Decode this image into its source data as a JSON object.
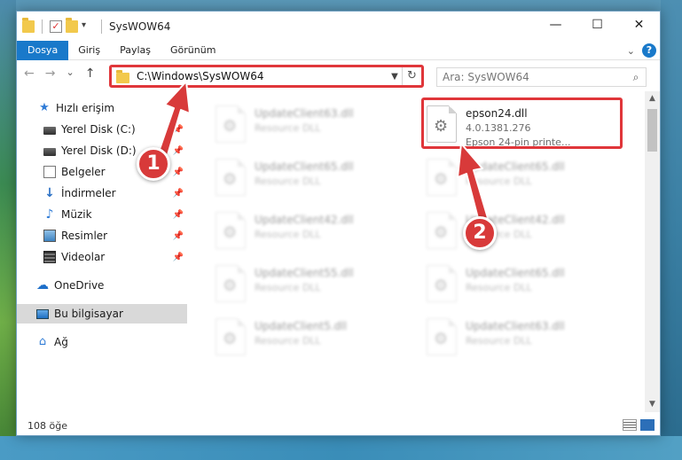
{
  "window": {
    "title": "SysWOW64",
    "controls": {
      "minimize": "—",
      "maximize": "☐",
      "close": "✕"
    }
  },
  "ribbon": {
    "tabs": [
      "Dosya",
      "Giriş",
      "Paylaş",
      "Görünüm"
    ],
    "expand_icon": "chevron-down-icon",
    "help_label": "?"
  },
  "nav": {
    "back": "←",
    "forward": "→",
    "recent": "⌄",
    "up": "↑",
    "address": "C:\\Windows\\SysWOW64",
    "refresh": "↻",
    "search_placeholder": "Ara: SysWOW64"
  },
  "sidebar": {
    "quick_access": "Hızlı erişim",
    "items": [
      {
        "label": "Yerel Disk (C:)",
        "icon": "drive-icon",
        "pinned": true
      },
      {
        "label": "Yerel Disk (D:)",
        "icon": "drive-icon",
        "pinned": true
      },
      {
        "label": "Belgeler",
        "icon": "documents-icon",
        "pinned": true
      },
      {
        "label": "İndirmeler",
        "icon": "download-icon",
        "pinned": true
      },
      {
        "label": "Müzik",
        "icon": "music-icon",
        "pinned": true
      },
      {
        "label": "Resimler",
        "icon": "pictures-icon",
        "pinned": true
      },
      {
        "label": "Videolar",
        "icon": "videos-icon",
        "pinned": true
      }
    ],
    "onedrive": "OneDrive",
    "this_pc": "Bu bilgisayar",
    "network": "Ağ"
  },
  "files": [
    {
      "name": "UpdateClient63.dll",
      "desc": "Resource DLL",
      "blurred": true
    },
    {
      "name": "epson24.dll",
      "version": "4.0.1381.276",
      "desc": "Epson 24-pin printe...",
      "blurred": false
    },
    {
      "name": "UpdateClient65.dll",
      "desc": "Resource DLL",
      "blurred": true
    },
    {
      "name": "UpdateClient65.dll",
      "desc": "Resource DLL",
      "blurred": true
    },
    {
      "name": "UpdateClient42.dll",
      "desc": "Resource DLL",
      "blurred": true
    },
    {
      "name": "UpdateClient42.dll",
      "desc": "Resource DLL",
      "blurred": true
    },
    {
      "name": "UpdateClient55.dll",
      "desc": "Resource DLL",
      "blurred": true
    },
    {
      "name": "UpdateClient65.dll",
      "desc": "Resource DLL",
      "blurred": true
    },
    {
      "name": "UpdateClient5.dll",
      "desc": "Resource DLL",
      "blurred": true
    },
    {
      "name": "UpdateClient63.dll",
      "desc": "Resource DLL",
      "blurred": true
    }
  ],
  "status": {
    "item_count": "108 öğe"
  },
  "annotations": {
    "step1": "1",
    "step2": "2",
    "color": "#d83a3a"
  }
}
